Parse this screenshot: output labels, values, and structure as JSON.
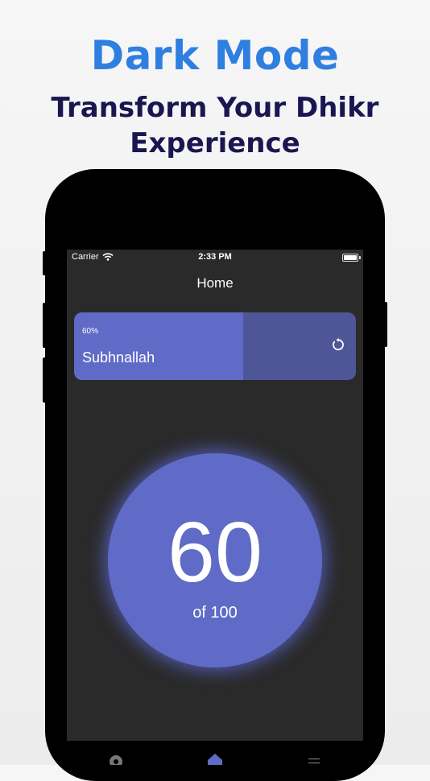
{
  "promo": {
    "title": "Dark Mode",
    "subtitle": "Transform Your Dhikr Experience"
  },
  "status_bar": {
    "carrier": "Carrier",
    "time": "2:33 PM"
  },
  "nav": {
    "title": "Home"
  },
  "progress_card": {
    "percent_label": "60%",
    "progress": 0.6,
    "dhikr_name": "Subhnallah"
  },
  "counter": {
    "value": "60",
    "of_label": "of 100"
  },
  "tab_bar": {
    "tabs": [
      {
        "icon": "gear-icon"
      },
      {
        "icon": "home-icon",
        "active": true
      },
      {
        "icon": "list-icon"
      }
    ]
  },
  "colors": {
    "accent": "#5f6bc6",
    "card_track": "#4f5697",
    "screen_bg": "#2a2a2a",
    "headline_blue": "#2f7fe0",
    "headline_navy": "#1a1650"
  }
}
